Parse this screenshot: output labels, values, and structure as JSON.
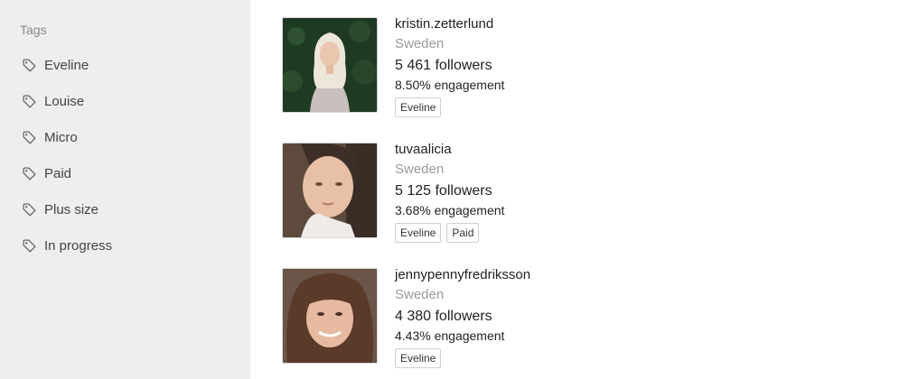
{
  "sidebar": {
    "title": "Tags",
    "items": [
      {
        "label": "Eveline"
      },
      {
        "label": "Louise"
      },
      {
        "label": "Micro"
      },
      {
        "label": "Paid"
      },
      {
        "label": "Plus size"
      },
      {
        "label": "In progress"
      }
    ]
  },
  "influencers": [
    {
      "username": "kristin.zetterlund",
      "country": "Sweden",
      "followers": "5 461 followers",
      "engagement": "8.50% engagement",
      "tags": [
        "Eveline"
      ]
    },
    {
      "username": "tuvaalicia",
      "country": "Sweden",
      "followers": "5 125 followers",
      "engagement": "3.68% engagement",
      "tags": [
        "Eveline",
        "Paid"
      ]
    },
    {
      "username": "jennypennyfredriksson",
      "country": "Sweden",
      "followers": "4 380 followers",
      "engagement": "4.43% engagement",
      "tags": [
        "Eveline"
      ]
    }
  ]
}
